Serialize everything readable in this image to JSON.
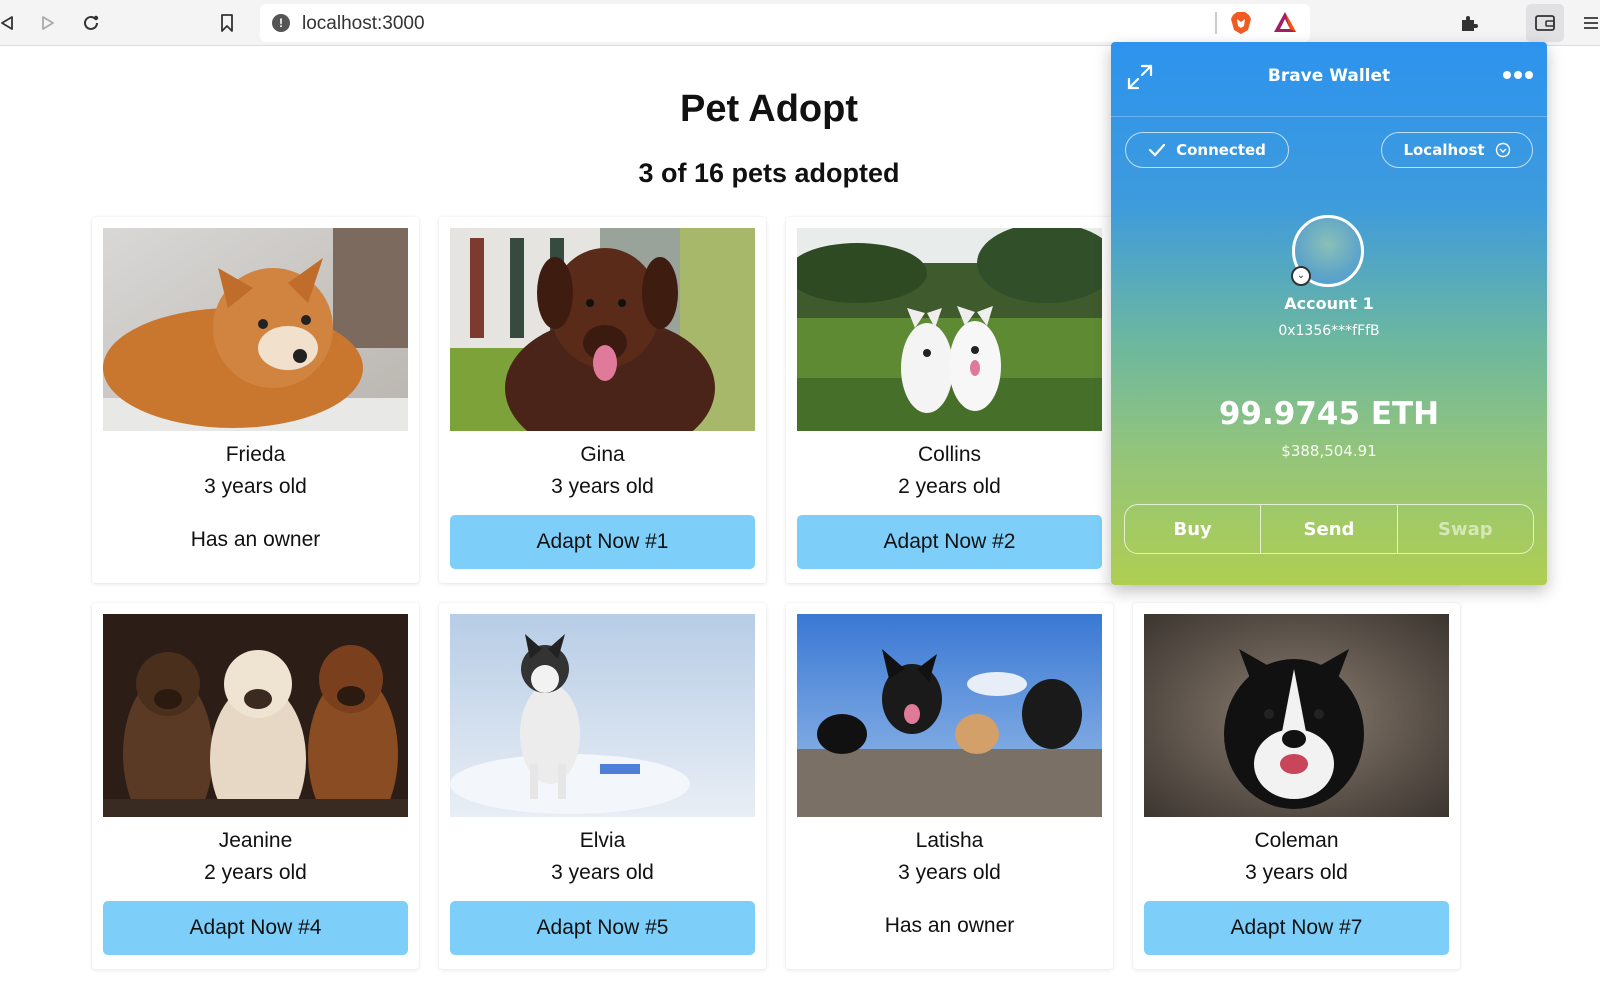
{
  "browser": {
    "url": "localhost:3000",
    "icons": [
      "back-icon",
      "forward-icon",
      "reload-icon",
      "bookmark-icon",
      "site-info-icon",
      "brave-shields-icon",
      "brave-rewards-icon",
      "extensions-icon",
      "wallet-icon",
      "menu-icon"
    ]
  },
  "page": {
    "title": "Pet Adopt",
    "subtitle": "3 of 16 pets adopted"
  },
  "pets": [
    {
      "name": "Frieda",
      "age": "3 years old",
      "status": "owned",
      "owner_label": "Has an owner",
      "button_label": "",
      "photo": "shiba-inu"
    },
    {
      "name": "Gina",
      "age": "3 years old",
      "status": "available",
      "owner_label": "",
      "button_label": "Adapt Now #1",
      "photo": "brown-dog"
    },
    {
      "name": "Collins",
      "age": "2 years old",
      "status": "available",
      "owner_label": "",
      "button_label": "Adapt Now #2",
      "photo": "white-dogs-field"
    },
    {
      "name": "",
      "age": "",
      "status": "hidden",
      "owner_label": "",
      "button_label": "",
      "photo": ""
    },
    {
      "name": "Jeanine",
      "age": "2 years old",
      "status": "available",
      "owner_label": "",
      "button_label": "Adapt Now #4",
      "photo": "three-dogs"
    },
    {
      "name": "Elvia",
      "age": "3 years old",
      "status": "available",
      "owner_label": "",
      "button_label": "Adapt Now #5",
      "photo": "husky-snow"
    },
    {
      "name": "Latisha",
      "age": "3 years old",
      "status": "owned",
      "owner_label": "Has an owner",
      "button_label": "",
      "photo": "dogs-on-wall"
    },
    {
      "name": "Coleman",
      "age": "3 years old",
      "status": "available",
      "owner_label": "",
      "button_label": "Adapt Now #7",
      "photo": "border-collie"
    }
  ],
  "wallet": {
    "title": "Brave Wallet",
    "connected_label": "Connected",
    "network": "Localhost",
    "account_name": "Account 1",
    "address": "0x1356***fFfB",
    "balance": "99.9745 ETH",
    "fiat_balance": "$388,504.91",
    "actions": [
      {
        "label": "Buy",
        "enabled": true
      },
      {
        "label": "Send",
        "enabled": true
      },
      {
        "label": "Swap",
        "enabled": false
      }
    ]
  },
  "colors": {
    "adopt_button": "#7dcffa",
    "wallet_gradient_top": "#2d93ee",
    "wallet_gradient_bottom": "#afce52"
  }
}
